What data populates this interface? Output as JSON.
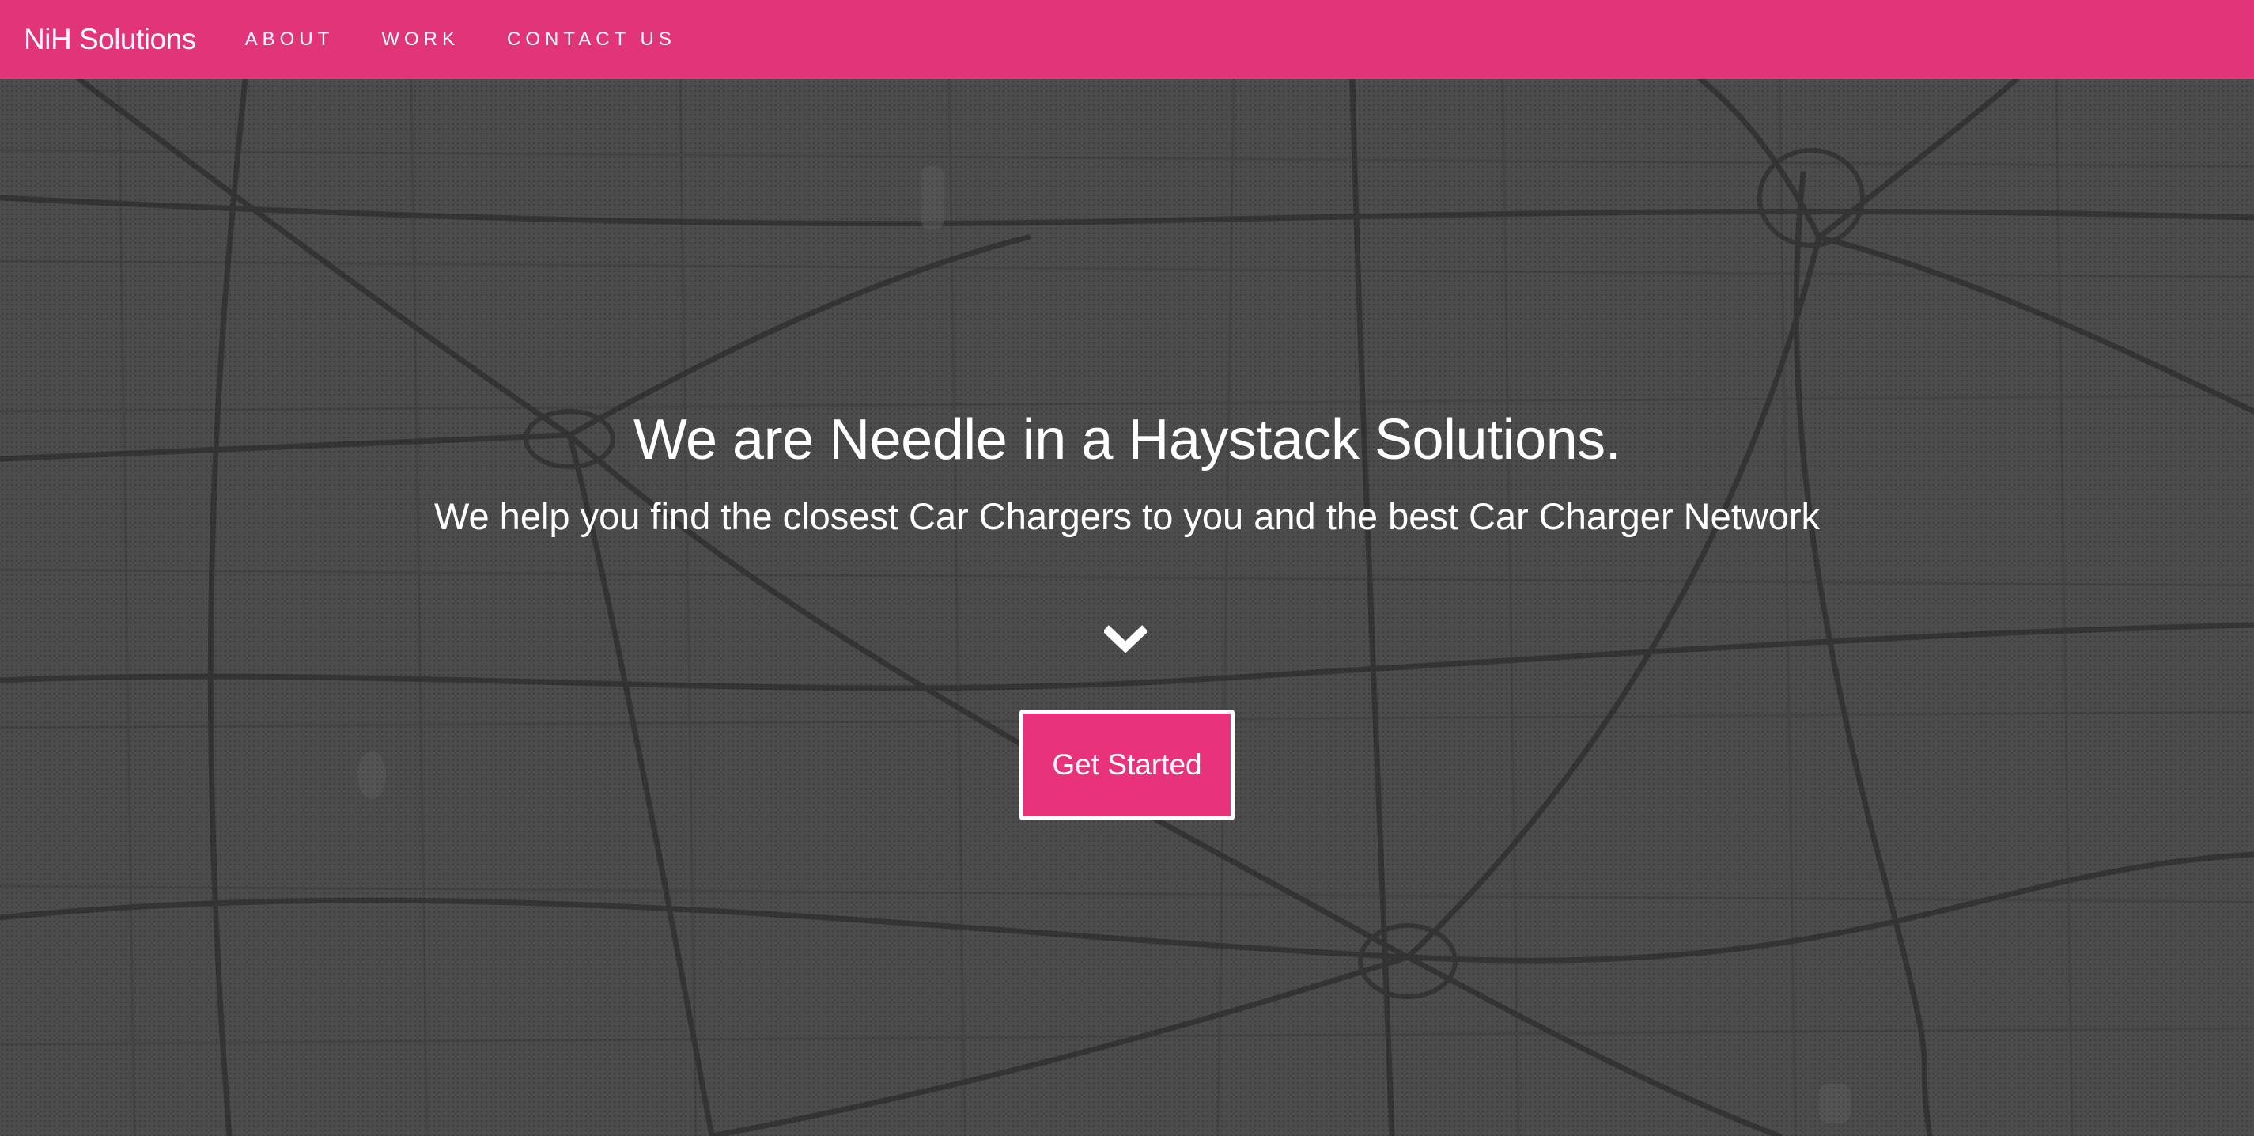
{
  "navbar": {
    "brand": "NiH Solutions",
    "links": [
      {
        "label": "ABOUT"
      },
      {
        "label": "WORK"
      },
      {
        "label": "CONTACT US"
      }
    ]
  },
  "hero": {
    "headline": "We are Needle in a Haystack Solutions.",
    "subheadline": "We help you find the closest Car Chargers to you and the best Car Charger Network",
    "scroll_icon": "chevron-down-icon",
    "cta_label": "Get Started",
    "background": "dark grey road map"
  },
  "colors": {
    "accent": "#e23479",
    "hero_bg": "#4b4b4b",
    "text": "#ffffff"
  }
}
